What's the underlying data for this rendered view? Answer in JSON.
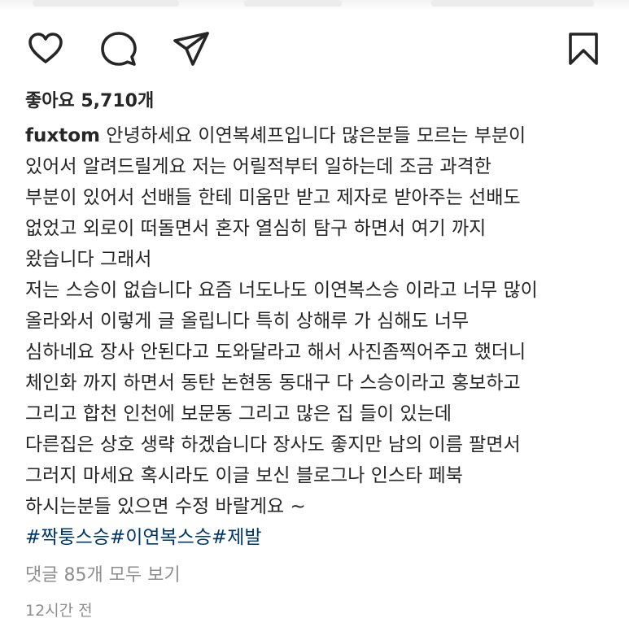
{
  "icons": {
    "like": "heart-icon",
    "comment": "comment-icon",
    "share": "share-icon",
    "save": "bookmark-icon"
  },
  "colors": {
    "text": "#262626",
    "hashtag": "#00376b",
    "muted": "#8e8e8e"
  },
  "post": {
    "likes_text": "좋아요 5,710개",
    "username": "fuxtom",
    "caption_lines": [
      "안녕하세요 이연복셰프입니다  많은분들 모르는 부분이",
      "있어서  알려드릴게요 저는 어릴적부터 일하는데 조금 과격한",
      "부분이 있어서 선배들 한테 미움만 받고 제자로 받아주는 선배도",
      "없었고 외로이 떠돌면서 혼자 열심히 탐구 하면서 여기 까지",
      "왔습니다 그래서",
      "저는 스승이 없습니다 요즘 너도나도 이연복스승 이라고 너무 많이",
      "올라와서 이렇게 글 올립니다 특히 상해루 가 심해도 너무",
      "심하네요 장사 안된다고 도와달라고 해서 사진좀찍어주고 했더니",
      "체인화 까지 하면서 동탄 논현동 동대구 다 스승이라고 홍보하고",
      "그리고 합천  인천에  보문동 그리고 많은 집 들이 있는데",
      "다른집은 상호 생략 하겠습니다 장사도 좋지만 남의 이름 팔면서",
      "그러지 마세요  혹시라도 이글 보신 블로그나 인스타 페북",
      "하시는분들 있으면 수정 바랄게요 ~"
    ],
    "hashtags": [
      "#짝퉁스승",
      "#이연복스승",
      "#제발"
    ],
    "comments_link": "댓글 85개 모두 보기",
    "timestamp": "12시간 전"
  }
}
